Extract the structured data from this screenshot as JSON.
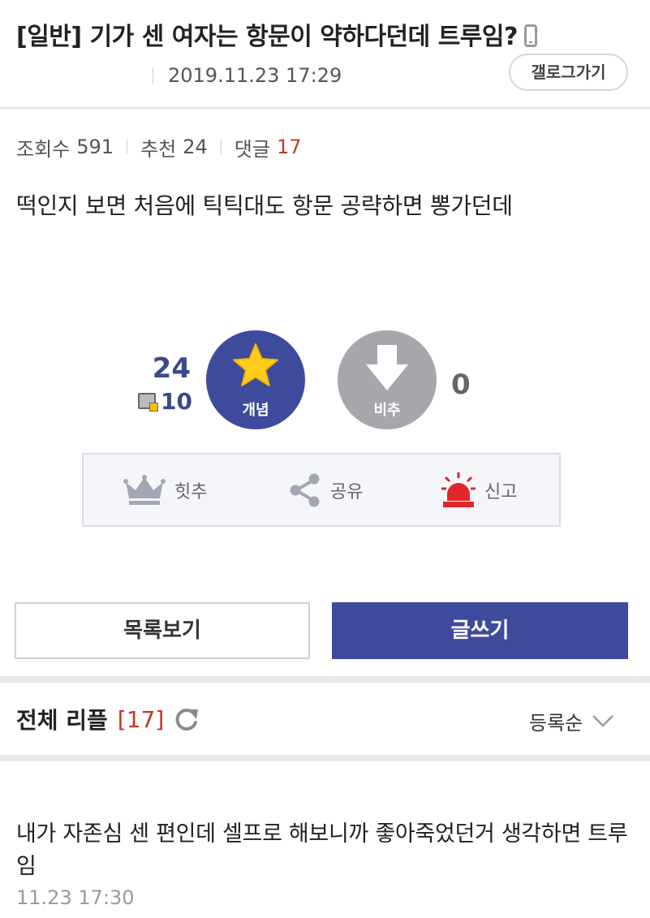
{
  "post": {
    "title": "[일반] 기가 센 여자는 항문이 약하다던데 트루임?",
    "date": "2019.11.23 17:29",
    "gallery_button": "갤로그가기",
    "stats": {
      "views_label": "조회수",
      "views": "591",
      "recommend_label": "추천",
      "recommend": "24",
      "comments_label": "댓글",
      "comments": "17"
    },
    "body": "떡인지 보면 처음에 틱틱대도 항문 공략하면 뽕가던데"
  },
  "vote": {
    "recommend_count": "24",
    "fix_count": "10",
    "up_label": "개념",
    "down_label": "비추",
    "nonrecommend_count": "0",
    "up_color": "#3e4a9c",
    "down_color": "#a5a7ad"
  },
  "actions": {
    "hit_label": "힛추",
    "share_label": "공유",
    "report_label": "신고"
  },
  "buttons": {
    "list_label": "목록보기",
    "write_label": "글쓰기"
  },
  "replies": {
    "title": "전체 리플",
    "count": "[17]",
    "sort_label": "등록순",
    "items": [
      {
        "text": "내가 자존심 센 편인데 셀프로 해보니까 좋아죽었던거 생각하면 트루임",
        "date": "11.23 17:30"
      }
    ]
  },
  "icons": [
    "phone-icon",
    "fix-icon",
    "star-icon",
    "thumb-down-arrow-icon",
    "crown-icon",
    "share-icon",
    "siren-icon",
    "refresh-icon",
    "chevron-down-icon"
  ]
}
